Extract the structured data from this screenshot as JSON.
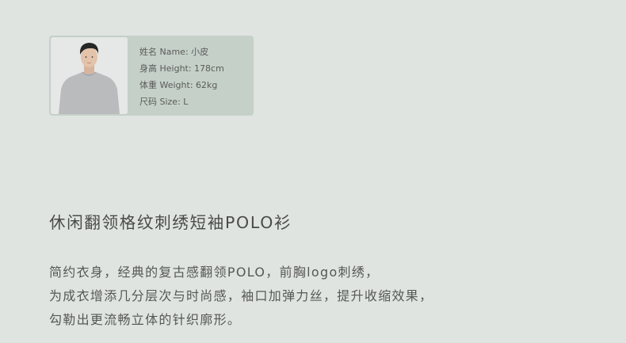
{
  "model": {
    "name": "姓名 Name: 小皮",
    "height": "身高 Height: 178cm",
    "weight": "体重 Weight: 62kg",
    "size": "尺码 Size: L"
  },
  "product": {
    "title": "休闲翻领格纹刺绣短袖POLO衫",
    "description": [
      "简约衣身，经典的复古感翻领POLO，前胸logo刺绣，",
      "为成衣增添几分层次与时尚感，袖口加弹力丝，提升收缩效果，",
      "勾勒出更流畅立体的针织廓形。"
    ]
  }
}
